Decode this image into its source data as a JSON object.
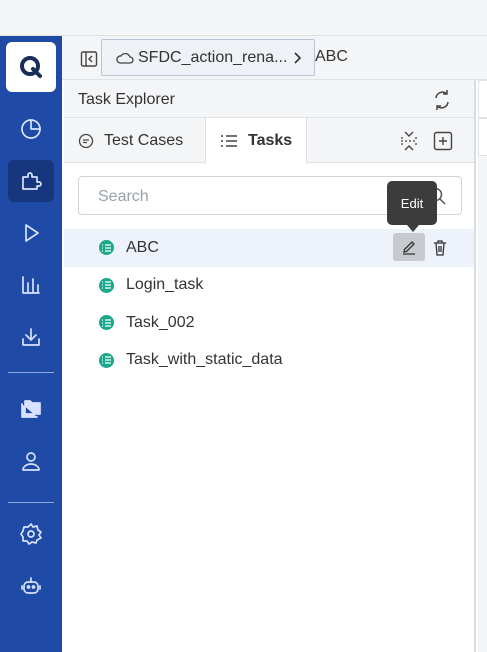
{
  "breadcrumb": {
    "project_label": "SFDC_action_rena...",
    "current_label": "ABC"
  },
  "panel": {
    "title": "Task Explorer",
    "tabs": [
      {
        "label": "Test Cases",
        "active": false
      },
      {
        "label": "Tasks",
        "active": true
      }
    ]
  },
  "search": {
    "placeholder": "Search"
  },
  "tasks": [
    {
      "label": "ABC",
      "selected": true
    },
    {
      "label": "Login_task",
      "selected": false
    },
    {
      "label": "Task_002",
      "selected": false
    },
    {
      "label": "Task_with_static_data",
      "selected": false
    }
  ],
  "tooltip": {
    "text": "Edit"
  },
  "sidebar": {
    "logo_text": "Q",
    "items": [
      {
        "icon": "pie-chart-icon"
      },
      {
        "icon": "puzzle-icon",
        "active": true
      },
      {
        "icon": "play-icon"
      },
      {
        "icon": "bar-chart-icon"
      },
      {
        "icon": "download-icon"
      },
      {
        "icon": "folders-icon"
      },
      {
        "icon": "user-icon"
      },
      {
        "icon": "gear-icon"
      },
      {
        "icon": "robot-icon"
      }
    ]
  },
  "colors": {
    "sidebar_bg": "#1f4aa6",
    "sidebar_active": "#16377d",
    "task_icon": "#1aa88a",
    "selected_row": "#edf2fb"
  }
}
